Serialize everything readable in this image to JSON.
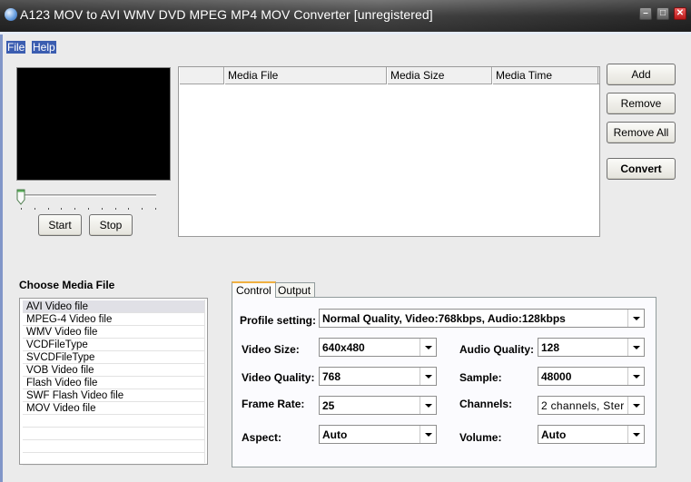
{
  "window": {
    "title": "A123 MOV  to AVI WMV DVD MPEG MP4 MOV Converter  [unregistered]",
    "controls": {
      "minimize": "–",
      "maximize": "□",
      "close": "✕"
    }
  },
  "menu": {
    "items": [
      {
        "label": "File"
      },
      {
        "label": "Help"
      }
    ]
  },
  "player": {
    "start_label": "Start",
    "stop_label": "Stop",
    "position_fraction": 0
  },
  "file_list": {
    "columns": [
      "",
      "Media File",
      "Media Size",
      "Media Time"
    ],
    "rows": []
  },
  "actions": {
    "add_label": "Add",
    "remove_label": "Remove",
    "remove_all_label": "Remove All",
    "convert_label": "Convert"
  },
  "media_types": {
    "title": "Choose Media File",
    "items": [
      "AVI Video file",
      "MPEG-4 Video file",
      "WMV Video file",
      "VCDFileType",
      "SVCDFileType",
      "VOB Video file",
      "Flash Video file",
      "SWF Flash Video file",
      "MOV Video file"
    ],
    "selected_index": 0
  },
  "settings": {
    "tabs": [
      {
        "label": "Control",
        "active": true
      },
      {
        "label": "Output",
        "active": false
      }
    ],
    "profile": {
      "label": "Profile setting:",
      "value": "Normal Quality, Video:768kbps, Audio:128kbps"
    },
    "video_size": {
      "label": "Video Size:",
      "value": "640x480"
    },
    "video_quality": {
      "label": "Video Quality:",
      "value": "768"
    },
    "frame_rate": {
      "label": "Frame Rate:",
      "value": "25"
    },
    "aspect": {
      "label": "Aspect:",
      "value": "Auto"
    },
    "audio_quality": {
      "label": "Audio Quality:",
      "value": "128"
    },
    "sample": {
      "label": "Sample:",
      "value": "48000"
    },
    "channels": {
      "label": "Channels:",
      "value": "2 channels, Ster"
    },
    "volume": {
      "label": "Volume:",
      "value": "Auto"
    }
  }
}
